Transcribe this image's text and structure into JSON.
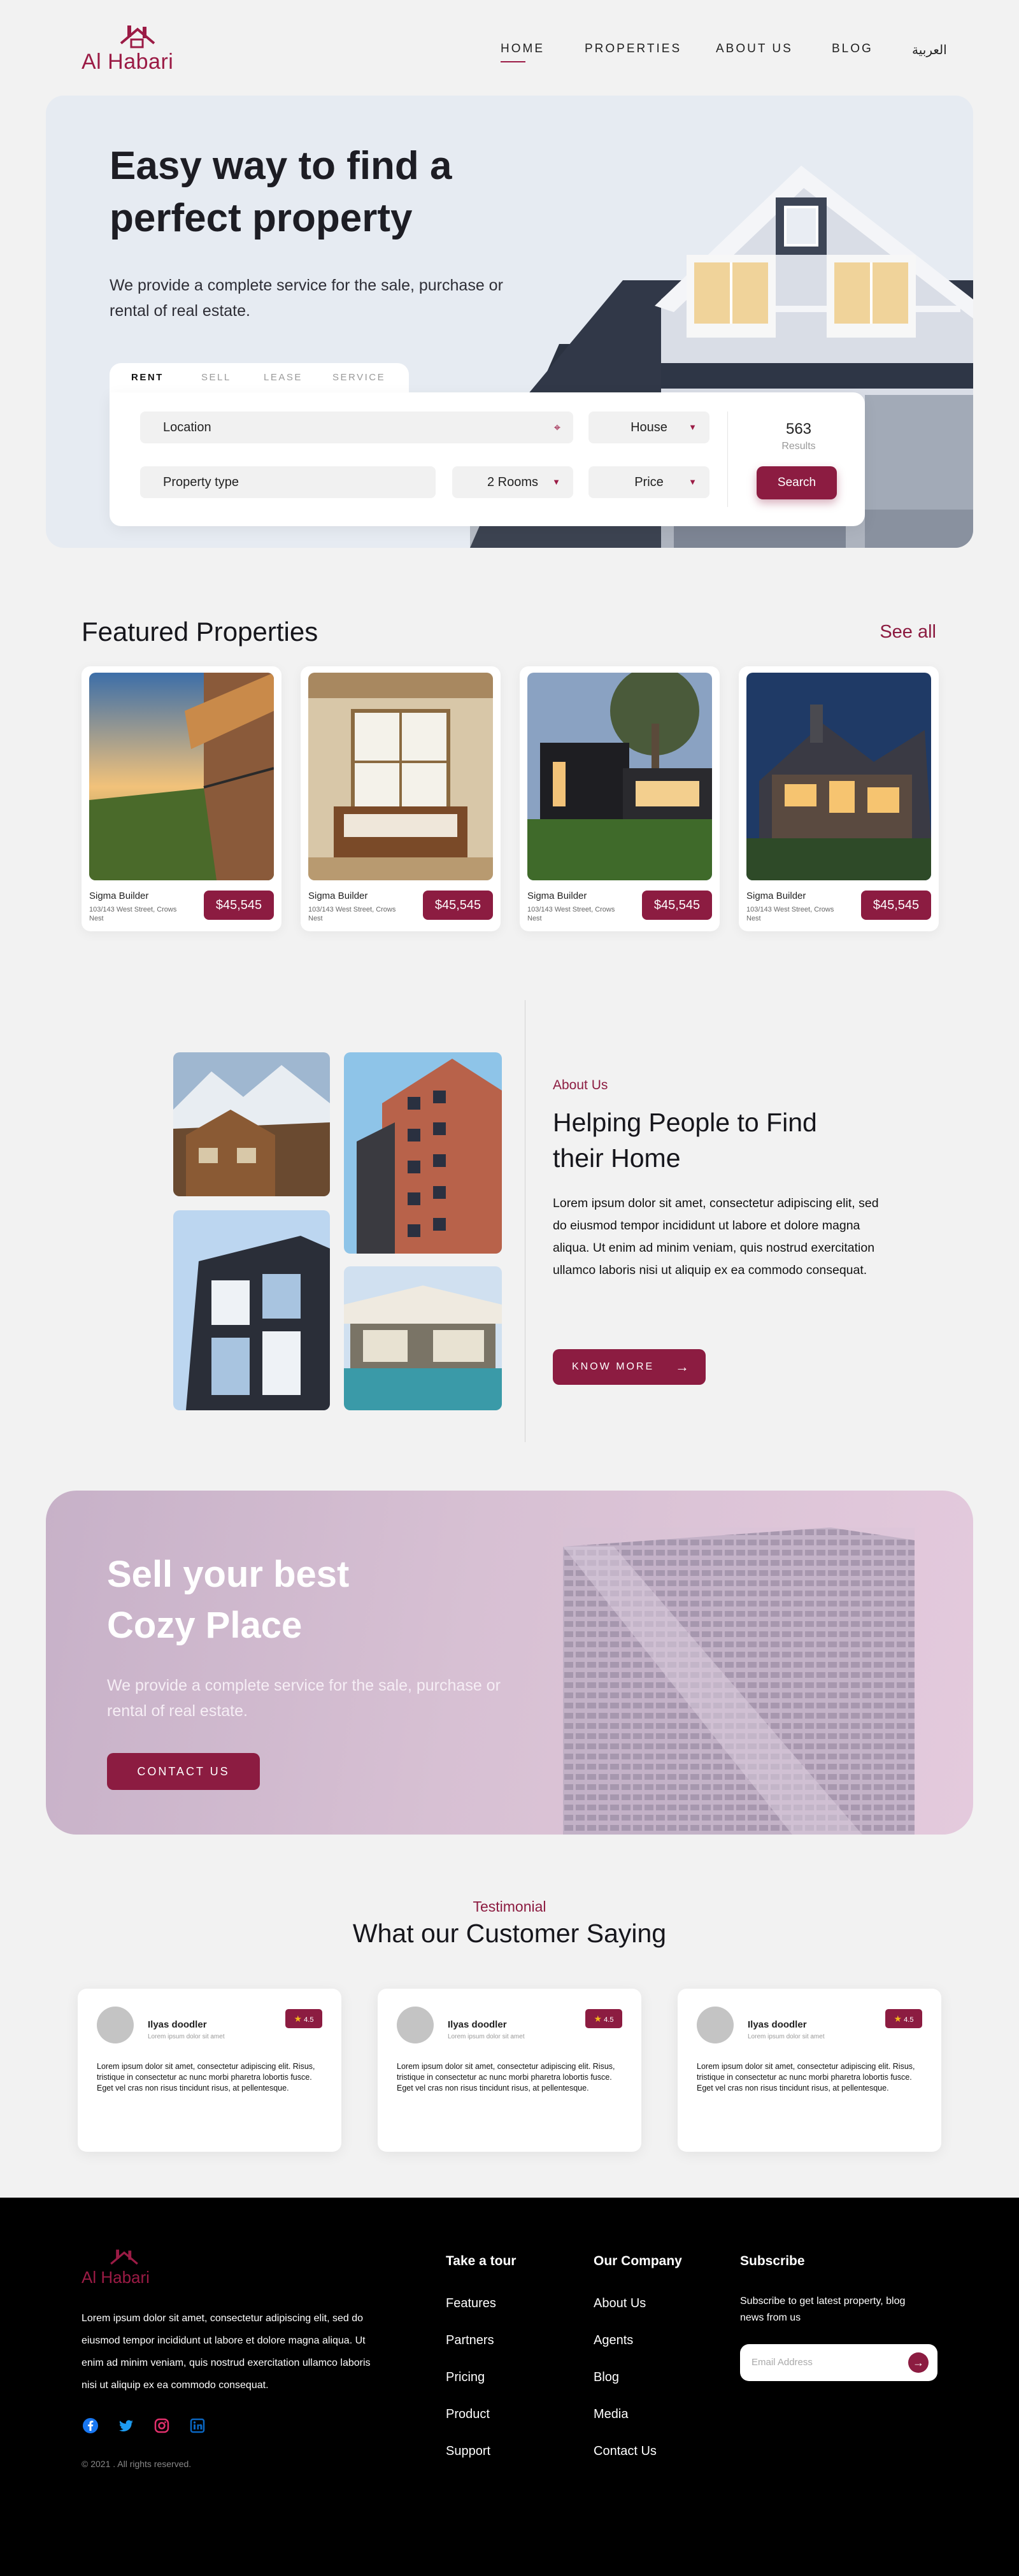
{
  "nav": {
    "logo_text": "Al Habari",
    "items": [
      "HOME",
      "PROPERTIES",
      "ABOUT US",
      "BLOG"
    ],
    "language": "العربية"
  },
  "hero": {
    "title": "Easy way to find a perfect property",
    "subtitle": "We provide a complete service for the sale, purchase or rental of real estate.",
    "tabs": [
      "RENT",
      "SELL",
      "LEASE",
      "SERVICE"
    ],
    "location_label": "Location",
    "house_type": "House",
    "property_type": "Property type",
    "rooms": "2 Rooms",
    "price": "Price",
    "results_count": "563",
    "results_label": "Results",
    "search_label": "Search"
  },
  "featured": {
    "title": "Featured Properties",
    "see_all": "See all",
    "cards": [
      {
        "name": "Sigma Builder",
        "address": "103/143 West Street, Crows Nest",
        "price": "$45,545"
      },
      {
        "name": "Sigma Builder",
        "address": "103/143 West Street, Crows Nest",
        "price": "$45,545"
      },
      {
        "name": "Sigma Builder",
        "address": "103/143 West Street, Crows Nest",
        "price": "$45,545"
      },
      {
        "name": "Sigma Builder",
        "address": "103/143 West Street, Crows Nest",
        "price": "$45,545"
      }
    ]
  },
  "about": {
    "tag": "About Us",
    "title": "Helping People to Find their Home",
    "body": "Lorem ipsum dolor sit amet, consectetur adipiscing elit, sed do eiusmod tempor incididunt ut labore et dolore magna aliqua. Ut enim ad minim veniam, quis nostrud exercitation ullamco laboris nisi ut aliquip ex ea commodo consequat.",
    "button": "KNOW MORE"
  },
  "sell": {
    "title": "Sell your best Cozy Place",
    "subtitle": "We provide a complete service for the sale, purchase or rental of real estate.",
    "button": "CONTACT US"
  },
  "testimonials": {
    "tag": "Testimonial",
    "title": "What our Customer Saying",
    "items": [
      {
        "name": "Ilyas doodler",
        "role": "Lorem ipsum dolor sit amet",
        "rating": "4.5",
        "text": "Lorem ipsum dolor sit amet, consectetur adipiscing elit. Risus, tristique in consectetur ac nunc morbi pharetra lobortis fusce. Eget vel cras non risus tincidunt risus, at pellentesque."
      },
      {
        "name": "Ilyas doodler",
        "role": "Lorem ipsum dolor sit amet",
        "rating": "4.5",
        "text": "Lorem ipsum dolor sit amet, consectetur adipiscing elit. Risus, tristique in consectetur ac nunc morbi pharetra lobortis fusce. Eget vel cras non risus tincidunt risus, at pellentesque."
      },
      {
        "name": "Ilyas doodler",
        "role": "Lorem ipsum dolor sit amet",
        "rating": "4.5",
        "text": "Lorem ipsum dolor sit amet, consectetur adipiscing elit. Risus, tristique in consectetur ac nunc morbi pharetra lobortis fusce. Eget vel cras non risus tincidunt risus, at pellentesque."
      }
    ]
  },
  "footer": {
    "logo_text": "Al Habari",
    "about": "Lorem ipsum dolor sit amet, consectetur adipiscing elit, sed do eiusmod tempor incididunt ut labore et dolore magna aliqua. Ut enim ad minim veniam, quis nostrud exercitation ullamco laboris nisi ut aliquip ex ea commodo consequat.",
    "copyright": "© 2021 . All rights reserved.",
    "social_icons": [
      "facebook-icon",
      "twitter-icon",
      "instagram-icon",
      "linkedin-icon"
    ],
    "tour": {
      "title": "Take a tour",
      "links": [
        "Features",
        "Partners",
        "Pricing",
        "Product",
        "Support"
      ]
    },
    "company": {
      "title": "Our Company",
      "links": [
        "About Us",
        "Agents",
        "Blog",
        "Media",
        "Contact Us"
      ]
    },
    "subscribe": {
      "title": "Subscribe",
      "text": "Subscribe to get latest property, blog news from us",
      "placeholder": "Email Address"
    }
  },
  "colors": {
    "brand": "#8c1c41",
    "hero_bg": "#e6ebf2",
    "footer_bg": "#000000"
  }
}
